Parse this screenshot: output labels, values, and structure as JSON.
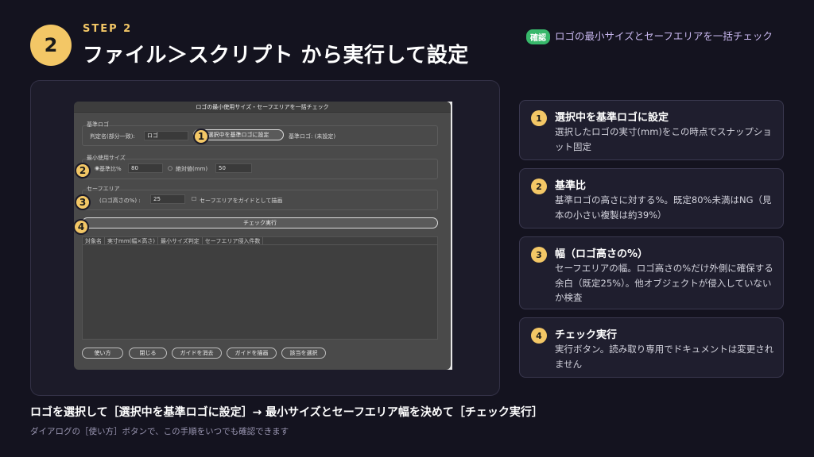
{
  "step": {
    "number": "2",
    "label": "STEP 2"
  },
  "title": "ファイル＞スクリプト から実行して設定",
  "tip": {
    "badge": "確認",
    "text": "ロゴの最小サイズとセーフエリアを一括チェック"
  },
  "dialog": {
    "title": "ロゴの最小使用サイズ・セーフエリアを一括チェック",
    "base_logo": {
      "section": "基準ロゴ",
      "match_label": "判定名(部分一致):",
      "match_value": "ロゴ",
      "set_button": "選択中を基準ロゴに設定",
      "status": "基準ロゴ: (未設定)"
    },
    "min_size": {
      "section": "最小使用サイズ",
      "ratio_label": "基準比%",
      "ratio_value": "80",
      "abs_label": "絶対値(mm)",
      "abs_value": "50"
    },
    "safe_area": {
      "section": "セーフエリア",
      "width_label": "(ロゴ高さの%) :",
      "width_value": "25",
      "guide_checkbox": "セーフエリアをガイドとして描画"
    },
    "check_button": "チェック実行",
    "table_columns": [
      "対象名",
      "実寸mm(幅×高さ)",
      "最小サイズ判定",
      "セーフエリア侵入件数"
    ],
    "footer_buttons": [
      "使い方",
      "閉じる",
      "ガイドを消去",
      "ガイドを描画",
      "該当を選択"
    ]
  },
  "cards": [
    {
      "num": "1",
      "title": "選択中を基準ロゴに設定",
      "desc": "選択したロゴの実寸(mm)をこの時点でスナップショット固定"
    },
    {
      "num": "2",
      "title": "基準比",
      "desc": "基準ロゴの高さに対する%。既定80%未満はNG（見本の小さい複製は約39%）"
    },
    {
      "num": "3",
      "title": "幅（ロゴ高さの%）",
      "desc": "セーフエリアの幅。ロゴ高さの%だけ外側に確保する余白（既定25%）。他オブジェクトが侵入していないか検査"
    },
    {
      "num": "4",
      "title": "チェック実行",
      "desc": "実行ボタン。読み取り専用でドキュメントは変更されません"
    }
  ],
  "markers": [
    "1",
    "2",
    "3",
    "4"
  ],
  "summary": "ロゴを選択して［選択中を基準ロゴに設定］→ 最小サイズとセーフエリア幅を決めて［チェック実行］",
  "note": "ダイアログの［使い方］ボタンで、この手順をいつでも確認できます",
  "colors": {
    "accent": "#f3c766",
    "tip_badge": "#38b86b",
    "background": "#14131f"
  }
}
